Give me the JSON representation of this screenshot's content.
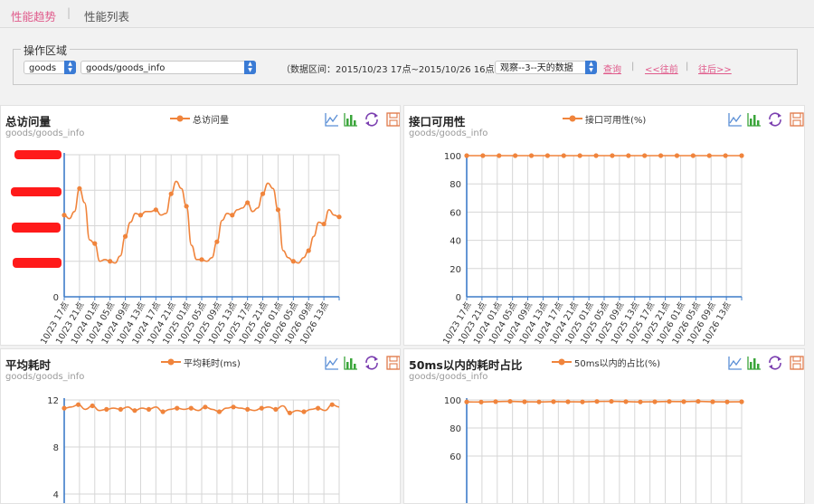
{
  "tabs": [
    {
      "label": "性能趋势",
      "active": true
    },
    {
      "label": "性能列表",
      "active": false
    }
  ],
  "tab_separator": "|",
  "operation": {
    "legend": "操作区域",
    "module_select": "goods",
    "interface_select": "goods/goods_info",
    "range_text": "（数据区间：2015/10/23 17点~2015/10/26 16点",
    "observe_select": "观察--3--天的数据",
    "query_label": "查询",
    "prev_label": "<<往前",
    "next_label": "往后>>",
    "separator": "|"
  },
  "colors": {
    "accent_pink": "#e05a8b",
    "series_orange": "#f0843c",
    "axis_blue": "#3d7cc9",
    "grid": "#d6d6d6",
    "select_blue": "#3a7bd5",
    "redaction": "#ff1a1a"
  },
  "icons": [
    "line-chart-icon",
    "bar-chart-icon",
    "refresh-icon",
    "save-icon"
  ],
  "panels": [
    {
      "title": "总访问量",
      "subtitle": "goods/goods_info",
      "legend": "总访问量",
      "y_labels_redacted": true,
      "y_zero_label": "0"
    },
    {
      "title": "接口可用性",
      "subtitle": "goods/goods_info",
      "legend": "接口可用性(%)"
    },
    {
      "title": "平均耗时",
      "subtitle": "goods/goods_info",
      "legend": "平均耗时(ms)"
    },
    {
      "title": "50ms以内的耗时占比",
      "subtitle": "goods/goods_info",
      "legend": "50ms以内的占比(%)"
    }
  ],
  "chart_data": [
    {
      "type": "line",
      "series": [
        {
          "name": "总访问量",
          "y_levels_of_4": [
            2.3,
            2.2,
            2.4,
            3.05,
            2.65,
            1.6,
            1.5,
            1.0,
            1.05,
            1.0,
            0.95,
            1.15,
            1.7,
            2.1,
            2.35,
            2.3,
            2.4,
            2.4,
            2.45,
            2.3,
            2.35,
            2.9,
            3.25,
            3.05,
            2.55,
            1.45,
            1.05,
            1.05,
            1.0,
            1.1,
            1.55,
            2.15,
            2.35,
            2.3,
            2.45,
            2.5,
            2.65,
            2.4,
            2.5,
            2.9,
            3.2,
            3.05,
            2.45,
            1.3,
            1.1,
            1.0,
            0.95,
            1.1,
            1.3,
            1.7,
            2.1,
            2.05,
            2.45,
            2.3,
            2.25
          ]
        }
      ],
      "x_tick_labels": [
        "10/23 17点",
        "10/23 21点",
        "10/24 01点",
        "10/24 05点",
        "10/24 09点",
        "10/24 13点",
        "10/24 17点",
        "10/24 21点",
        "10/25 01点",
        "10/25 05点",
        "10/25 09点",
        "10/25 13点",
        "10/25 17点",
        "10/25 21点",
        "10/26 01点",
        "10/26 05点",
        "10/26 09点",
        "10/26 13点"
      ],
      "ylim": [
        0,
        4
      ],
      "grid": true
    },
    {
      "type": "line",
      "series": [
        {
          "name": "接口可用性(%)",
          "values": [
            100,
            100,
            100,
            100,
            100,
            100,
            100,
            100,
            100,
            100,
            100,
            100,
            100,
            100,
            100,
            100,
            100,
            100
          ]
        }
      ],
      "x_tick_labels": [
        "10/23 17点",
        "10/23 21点",
        "10/24 01点",
        "10/24 05点",
        "10/24 09点",
        "10/24 13点",
        "10/24 17点",
        "10/24 21点",
        "10/25 01点",
        "10/25 05点",
        "10/25 09点",
        "10/25 13点",
        "10/25 17点",
        "10/25 21点",
        "10/26 01点",
        "10/26 05点",
        "10/26 09点",
        "10/26 13点"
      ],
      "y_tick_labels": [
        "0",
        "20",
        "40",
        "60",
        "80",
        "100"
      ],
      "ylim": [
        0,
        100
      ],
      "grid": true
    },
    {
      "type": "line",
      "series": [
        {
          "name": "平均耗时(ms)",
          "values": [
            11.3,
            11.4,
            11.6,
            11.2,
            11.5,
            11.1,
            11.2,
            11.3,
            11.2,
            11.4,
            11.1,
            11.3,
            11.2,
            11.4,
            11.0,
            11.2,
            11.3,
            11.2,
            11.3,
            11.1,
            11.4,
            11.2,
            11.0,
            11.3,
            11.4,
            11.3,
            11.2,
            11.1,
            11.3,
            11.4,
            11.2,
            11.5,
            10.9,
            11.1,
            11.0,
            11.2,
            11.3,
            11.1,
            11.6,
            11.4
          ]
        }
      ],
      "y_tick_labels": [
        "4",
        "8",
        "12"
      ],
      "ylim": [
        4,
        12
      ],
      "grid": true
    },
    {
      "type": "line",
      "series": [
        {
          "name": "50ms以内的占比(%)",
          "values": [
            98.6,
            98.5,
            98.8,
            99.0,
            98.7,
            98.6,
            98.8,
            98.7,
            98.6,
            98.9,
            99.0,
            98.8,
            98.6,
            98.7,
            98.9,
            98.8,
            99.0,
            98.7,
            98.6,
            98.7
          ]
        }
      ],
      "y_tick_labels": [
        "100",
        "80",
        "60"
      ],
      "ylim": [
        0,
        100
      ],
      "grid": true
    }
  ]
}
